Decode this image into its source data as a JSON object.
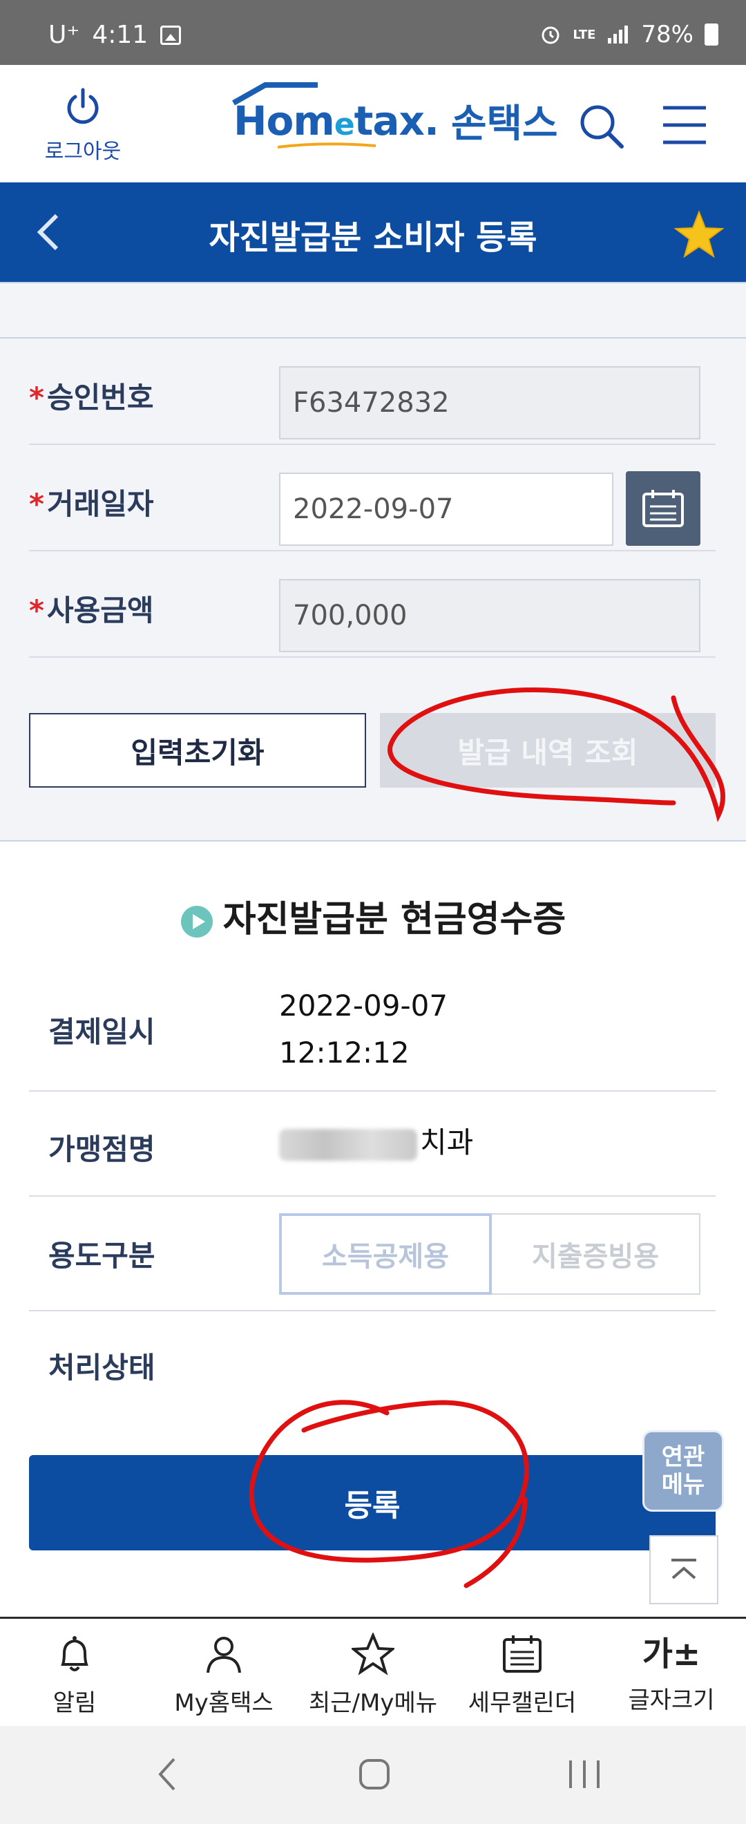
{
  "status_bar": {
    "carrier": "U⁺",
    "time": "4:11",
    "network": "LTE",
    "battery": "78%"
  },
  "header": {
    "logout_label": "로그아웃",
    "logo_text_1": "Hom",
    "logo_text_e": "e",
    "logo_text_2": "tax.",
    "logo_ko": "손택스"
  },
  "title_bar": {
    "title": "자진발급분 소비자 등록"
  },
  "form": {
    "approval_label": "승인번호",
    "approval_value": "F63472832",
    "date_label": "거래일자",
    "date_value": "2022-09-07",
    "amount_label": "사용금액",
    "amount_value": "700,000",
    "required_mark": "*",
    "reset_button": "입력초기화",
    "query_button": "발급 내역 조회"
  },
  "receipt": {
    "title": "자진발급분 현금영수증",
    "payment_datetime_label": "결제일시",
    "payment_date": "2022-09-07",
    "payment_time": "12:12:12",
    "merchant_label": "가맹점명",
    "merchant_value_suffix": "치과",
    "usage_label": "용도구분",
    "usage_options": [
      "소득공제용",
      "지출증빙용"
    ],
    "status_label": "처리상태",
    "status_value": "",
    "register_button": "등록",
    "related_menu_line1": "연관",
    "related_menu_line2": "메뉴"
  },
  "bottom_nav": {
    "items": [
      {
        "label": "알림",
        "icon": "bell-icon"
      },
      {
        "label": "My홈택스",
        "icon": "person-icon"
      },
      {
        "label": "최근/My메뉴",
        "icon": "star-outline-icon"
      },
      {
        "label": "세무캘린더",
        "icon": "calendar-icon"
      },
      {
        "label": "글자크기",
        "icon": "font-size-icon",
        "glyph": "가±"
      }
    ]
  },
  "colors": {
    "brand_blue": "#0c4da2",
    "annotation_red": "#e01010",
    "star_yellow": "#f6c21c"
  }
}
